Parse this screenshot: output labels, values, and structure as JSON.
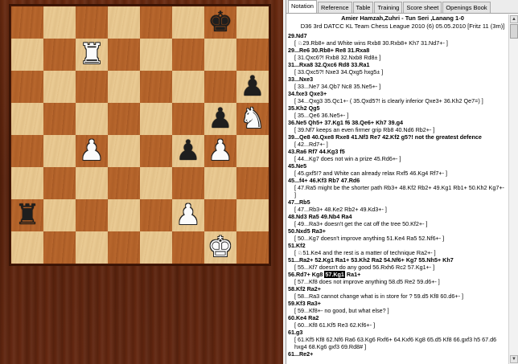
{
  "board": {
    "squares_light_color": "#eacb94",
    "squares_dark_color": "#b8672d",
    "pieces": [
      {
        "name": "black-king-icon",
        "glyph": "♚",
        "color": "black",
        "square": "g8"
      },
      {
        "name": "white-rook-icon",
        "glyph": "♜",
        "color": "white",
        "square": "c7"
      },
      {
        "name": "black-pawn-icon",
        "glyph": "♟",
        "color": "black",
        "square": "h6"
      },
      {
        "name": "black-pawn-icon",
        "glyph": "♟",
        "color": "black",
        "square": "g5"
      },
      {
        "name": "white-knight-icon",
        "glyph": "♞",
        "color": "white",
        "square": "h5"
      },
      {
        "name": "black-pawn-icon",
        "glyph": "♟",
        "color": "black",
        "square": "f4"
      },
      {
        "name": "white-pawn-icon",
        "glyph": "♟",
        "color": "white",
        "square": "c4"
      },
      {
        "name": "white-pawn-icon",
        "glyph": "♟",
        "color": "white",
        "square": "g4"
      },
      {
        "name": "black-rook-icon",
        "glyph": "♜",
        "color": "black",
        "square": "a2"
      },
      {
        "name": "white-pawn-icon",
        "glyph": "♟",
        "color": "white",
        "square": "f2"
      },
      {
        "name": "white-king-icon",
        "glyph": "♚",
        "color": "white",
        "square": "g1"
      }
    ]
  },
  "tabs": [
    {
      "label": "Notation",
      "active": true
    },
    {
      "label": "Reference",
      "active": false
    },
    {
      "label": "Table",
      "active": false
    },
    {
      "label": "Training",
      "active": false
    },
    {
      "label": "Score sheet",
      "active": false
    },
    {
      "label": "Openings Book",
      "active": false
    }
  ],
  "header": {
    "players": "Amier Hamzah,Zuhri - Tun Seri ,Lanang  1-0",
    "event": "D36 3rd DATCC KL Team Chess League 2010 (6) 05.05.2010 [Fritz 11 (3m)]"
  },
  "moves": [
    {
      "t": "mv",
      "text": "29.Nd7"
    },
    {
      "t": "cm",
      "text": "[ ♘29.Rb8+ and White wins  Rxb8  30.Rxb8+  Kh7  31.Nd7+- ]"
    },
    {
      "t": "mv",
      "text": "29...Re6  30.Rb8+  Re8  31.Rxa8"
    },
    {
      "t": "cm",
      "text": "[ 31.Qxc6?!  Rxb8  32.Nxb8  Rd8± ]"
    },
    {
      "t": "mv",
      "text": "31...Rxa8  32.Qxc6  Rd8  33.Ra1"
    },
    {
      "t": "cm",
      "text": "[ 33.Qxc5?!  Nxe3  34.Qxg5  hxg5± ]"
    },
    {
      "t": "mv",
      "text": "33...Nxe3"
    },
    {
      "t": "cm",
      "text": "[ 33...Ne7  34.Qb7  Nc8  35.Ne5+- ]"
    },
    {
      "t": "mv",
      "text": "34.fxe3  Qxe3+"
    },
    {
      "t": "cm",
      "text": "[ 34...Qxg3  35.Qc1+- ( 35.Qxd5?! is clearly inferior  Qxe3+  36.Kh2  Qe7=) ]"
    },
    {
      "t": "mv",
      "text": "35.Kh2  Qg5"
    },
    {
      "t": "cm",
      "text": "[ 35...Qe6  36.Ne5+- ]"
    },
    {
      "t": "mv",
      "text": "36.Ne5  Qh5+  37.Kg1  f6  38.Qe6+  Kh7  39.g4"
    },
    {
      "t": "cm",
      "text": "[ 39.Nf7 keeps an even firmer grip  Rb8  40.Nd6  Rb2+- ]"
    },
    {
      "t": "mv",
      "text": "39...Qe8  40.Qxe8  Rxe8  41.Nf3  Re7  42.Kf2  g5?! not the greatest defence"
    },
    {
      "t": "cm",
      "text": "[ 42...Rd7+- ]"
    },
    {
      "t": "mv",
      "text": "43.Ra6  Rf7  44.Kg3  f5"
    },
    {
      "t": "cm",
      "text": "[ 44...Kg7 does not win a prize  45.Rd6+- ]"
    },
    {
      "t": "mv",
      "text": "45.Ne5"
    },
    {
      "t": "cm",
      "text": "[ 45.gxf5!? and White can already relax  Rxf5  46.Kg4  Rf7+- ]"
    },
    {
      "t": "mv",
      "text": "45...f4+  46.Kf3  Rb7  47.Rd6"
    },
    {
      "t": "cm",
      "text": "[ 47.Ra5 might be the shorter path  Rb3+  48.Kf2  Rb2+  49.Kg1  Rb1+  50.Kh2  Kg7+- ]"
    },
    {
      "t": "mv",
      "text": "47...Rb5"
    },
    {
      "t": "cm",
      "text": "[ 47...Rb3+  48.Ke2  Rb2+  49.Kd3+- ]"
    },
    {
      "t": "mv",
      "text": "48.Nd3  Ra5  49.Nb4  Ra4"
    },
    {
      "t": "cm",
      "text": "[ 49...Ra3+ doesn't get the cat off the tree  50.Kf2+- ]"
    },
    {
      "t": "mv",
      "text": "50.Nxd5  Ra3+"
    },
    {
      "t": "cm",
      "text": "[ 50...Kg7 doesn't improve anything  51.Ke4  Ra5  52.Nf6+- ]"
    },
    {
      "t": "mv",
      "text": "51.Kf2"
    },
    {
      "t": "cm",
      "text": "[ ♘51.Ke4 and the rest is a matter of technique  Ra2+- ]"
    },
    {
      "t": "mv",
      "text": "51...Ra2+  52.Kg1  Ra1+  53.Kh2  Ra2  54.Nf6+  Kg7  55.Nh5+  Kh7"
    },
    {
      "t": "cm",
      "text": "[ 55...Kf7 doesn't do any good  56.Rxh6  Rc2  57.Kg1+- ]"
    },
    {
      "t": "mvhl",
      "before": "56.Rd7+  Kg8 ",
      "hl": "57.Kg1",
      "after": " Ra1+"
    },
    {
      "t": "cm",
      "text": "[ 57...Kf8 does not improve anything  58.d5  Re2  59.d6+- ]"
    },
    {
      "t": "mv",
      "text": "58.Kf2  Ra2+"
    },
    {
      "t": "cm",
      "text": "[ 58...Ra3 cannot change what is in store for ?  59.d5  Kf8  60.d6+- ]"
    },
    {
      "t": "mv",
      "text": "59.Kf3  Ra3+"
    },
    {
      "t": "cm",
      "text": "[ 59...Kf8+- no good, but what else? ]"
    },
    {
      "t": "mv",
      "text": "60.Ke4  Ra2"
    },
    {
      "t": "cm",
      "text": "[ 60...Kf8  61.Kf5  Re3  62.Kf6+- ]"
    },
    {
      "t": "mv",
      "text": "61.g3"
    },
    {
      "t": "cm",
      "text": "[ 61.Kf5  Kf8  62.Nf6  Ra6  63.Kg6  Rxf6+  64.Kxf6  Kg8  65.d5  Kf8  66.gxf3  h5  67.d6  hxg4  68.Kg6  gxf3  69.Rd8# ]"
    },
    {
      "t": "mv",
      "text": "61...Re2+"
    }
  ]
}
